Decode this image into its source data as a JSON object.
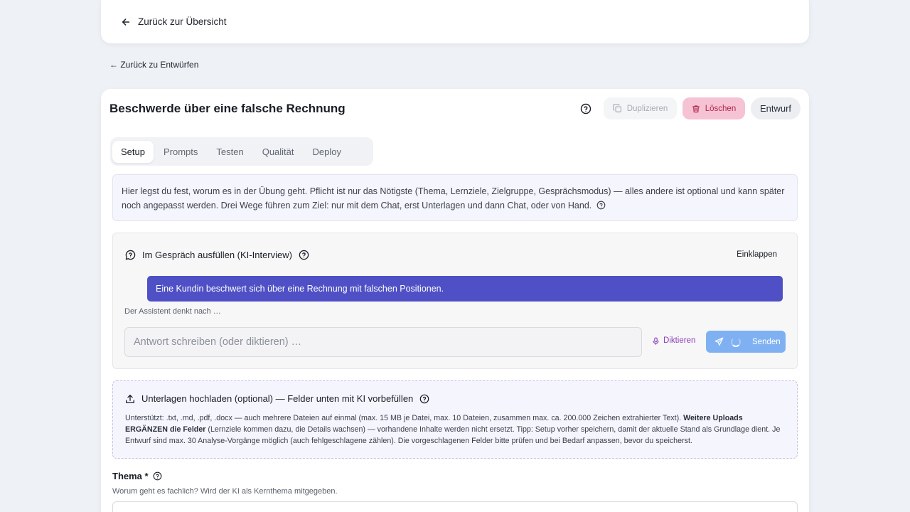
{
  "topbar": {
    "back_overview": "Zurück zur Übersicht"
  },
  "nav": {
    "back_drafts": "← Zurück zu Entwürfen"
  },
  "header": {
    "title": "Beschwerde über eine falsche Rechnung",
    "duplicate_label": "Duplizieren",
    "delete_label": "Löschen",
    "status_badge": "Entwurf"
  },
  "tabs": [
    {
      "label": "Setup",
      "active": true
    },
    {
      "label": "Prompts"
    },
    {
      "label": "Testen"
    },
    {
      "label": "Qualität"
    },
    {
      "label": "Deploy"
    }
  ],
  "intro": {
    "text": "Hier legst du fest, worum es in der Übung geht. Pflicht ist nur das Nötigste (Thema, Lernziele, Zielgruppe, Gesprächsmodus) — alles andere ist optional und kann später noch angepasst werden. Drei Wege führen zum Ziel: nur mit dem Chat, erst Unterlagen und dann Chat, oder von Hand."
  },
  "chat": {
    "heading": "Im Gespräch ausfüllen (KI-Interview)",
    "collapse_label": "Einklappen",
    "user_message": "Eine Kundin beschwert sich über eine Rechnung mit falschen Positionen.",
    "thinking_text": "Der Assistent denkt nach …",
    "answer_placeholder": "Antwort schreiben (oder diktieren) …",
    "dictate_label": "Diktieren",
    "send_label": "Senden"
  },
  "upload": {
    "heading": "Unterlagen hochladen (optional) — Felder unten mit KI vorbefüllen",
    "text_part1": "Unterstützt: .txt, .md, .pdf, .docx — auch mehrere Dateien auf einmal (max. 15 MB je Datei, max. 10 Dateien, zusammen max. ca. 200.000 Zeichen extrahierter Text). ",
    "text_bold": "Weitere Uploads ERGÄNZEN die Felder",
    "text_part2": " (Lernziele kommen dazu, die Details wachsen) — vorhandene Inhalte werden nicht ersetzt. Tipp: Setup vorher speichern, damit der aktuelle Stand als Grundlage dient. Je Entwurf sind max. 30 Analyse-Vorgänge möglich (auch fehlgeschlagene zählen). Die vorgeschlagenen Felder bitte prüfen und bei Bedarf anpassen, bevor du speicherst."
  },
  "field_topic": {
    "label": "Thema *",
    "hint": "Worum geht es fachlich? Wird der KI als Kernthema mitgegeben."
  },
  "colors": {
    "accent": "#4f50c5",
    "send": "#7fb1f2",
    "delete_bg": "#f6c3d4",
    "delete_text": "#b0254f",
    "dictate": "#8b3fb8"
  }
}
